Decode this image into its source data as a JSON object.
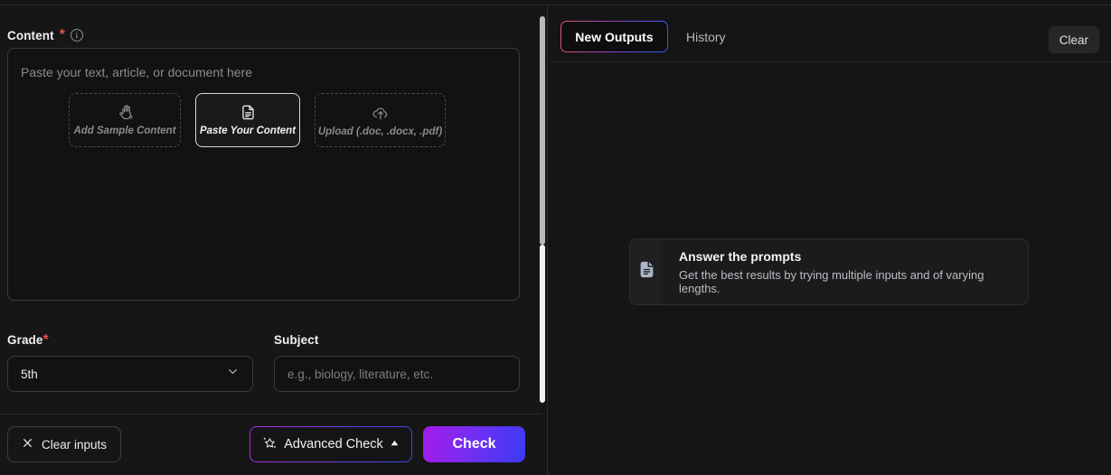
{
  "left_panel": {
    "content_label": "Content",
    "required_mark": "*",
    "info_icon": "info-circle-icon",
    "textarea_placeholder": "Paste your text, article, or document here",
    "source_buttons": [
      {
        "label": "Add Sample Content",
        "icon": "waving-hand-icon",
        "active": false
      },
      {
        "label": "Paste Your Content",
        "icon": "document-lines-icon",
        "active": true
      },
      {
        "label": "Upload (.doc, .docx, .pdf)",
        "icon": "cloud-upload-icon",
        "active": false
      }
    ],
    "grade": {
      "label": "Grade",
      "required_mark": "*",
      "value": "5th",
      "chevron_icon": "chevron-down-icon"
    },
    "subject": {
      "label": "Subject",
      "placeholder": "e.g., biology, literature, etc."
    },
    "actions": {
      "clear_inputs_label": "Clear inputs",
      "clear_inputs_icon": "close-x-icon",
      "advanced_check_label": "Advanced Check",
      "advanced_check_icon": "magic-sparkle-star-icon",
      "advanced_check_caret_icon": "caret-up-icon",
      "check_label": "Check"
    }
  },
  "right_panel": {
    "tabs": [
      {
        "label": "New Outputs",
        "active": true
      },
      {
        "label": "History",
        "active": false
      }
    ],
    "clear_label": "Clear",
    "empty_state": {
      "icon": "document-lines-icon",
      "title": "Answer the prompts",
      "subtitle": "Get the best results by trying multiple inputs and of varying lengths."
    }
  },
  "colors": {
    "required_red": "#e0524a",
    "check_gradient_start": "#a41ce9",
    "check_gradient_end": "#3b3bf5",
    "advanced_border_start": "#b02ae0",
    "advanced_border_end": "#3a48e6",
    "tab_border_start": "#e0566a",
    "tab_border_end": "#2f5cf0",
    "page_background": "#151516",
    "card_icon": "#a9b6c8"
  }
}
